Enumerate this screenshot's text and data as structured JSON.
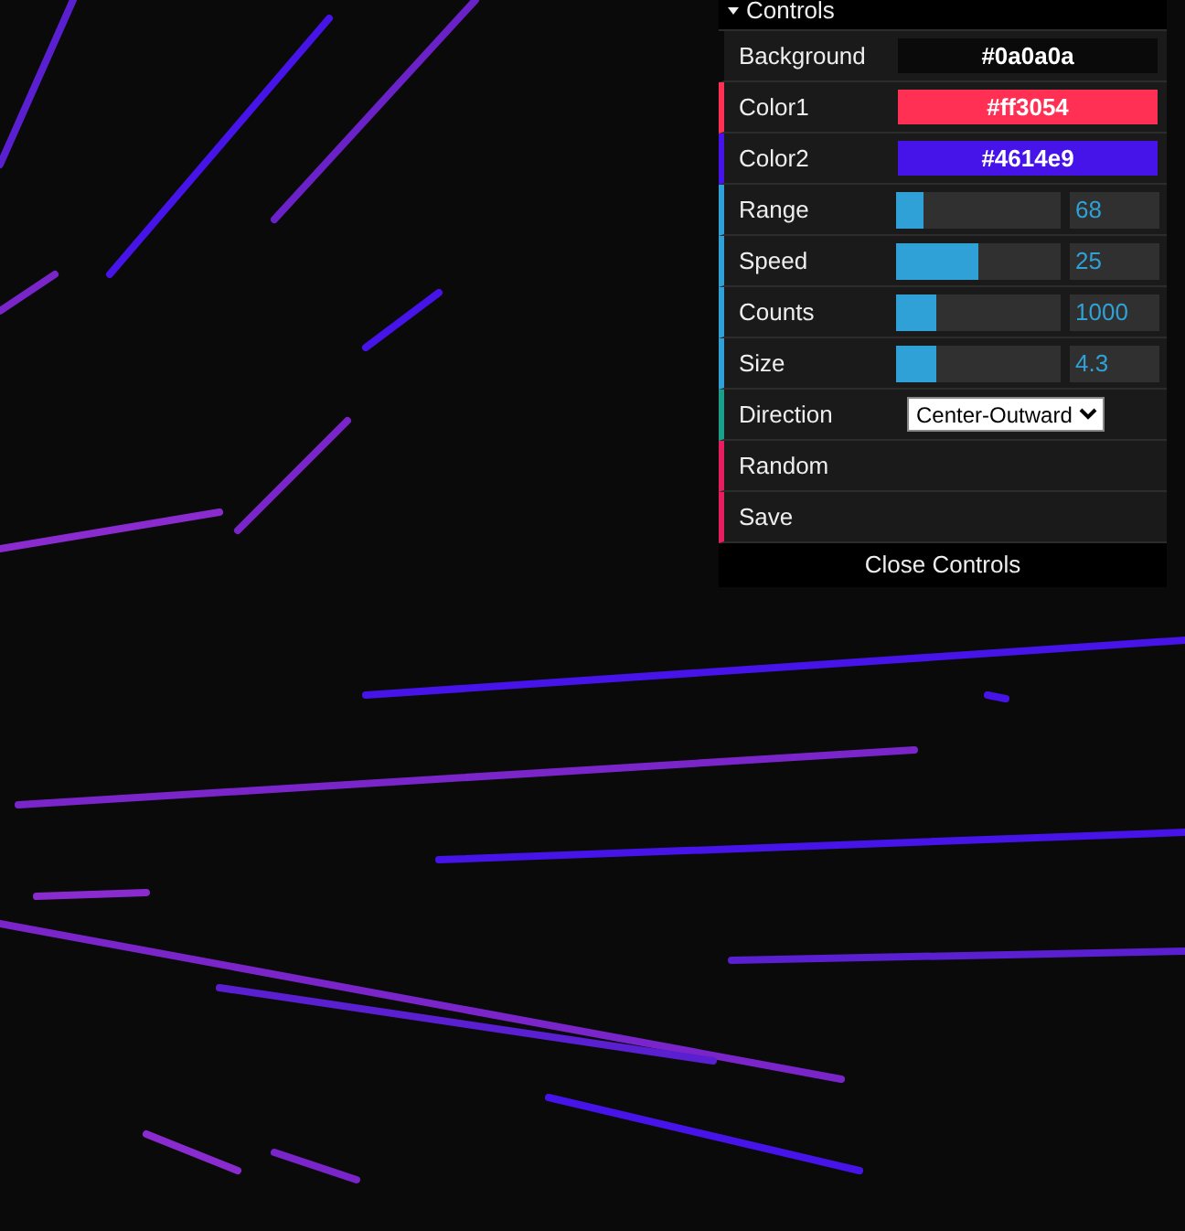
{
  "controls": {
    "title": "Controls",
    "expanded": true,
    "rows": [
      {
        "kind": "color",
        "label": "Background",
        "value": "#0a0a0a",
        "color": "#0a0a0a"
      },
      {
        "kind": "color",
        "label": "Color1",
        "value": "#ff3054",
        "color": "#ff3054"
      },
      {
        "kind": "color",
        "label": "Color2",
        "value": "#4614e9",
        "color": "#4614e9"
      },
      {
        "kind": "slider",
        "label": "Range",
        "value": "68",
        "level": 0.17
      },
      {
        "kind": "slider",
        "label": "Speed",
        "value": "25",
        "level": 0.5
      },
      {
        "kind": "slider",
        "label": "Counts",
        "value": "1000",
        "level": 0.24
      },
      {
        "kind": "slider",
        "label": "Size",
        "value": "4.3",
        "level": 0.24
      },
      {
        "kind": "select",
        "label": "Direction",
        "value": "Center-Outward"
      },
      {
        "kind": "button",
        "label": "Random"
      },
      {
        "kind": "button",
        "label": "Save"
      }
    ],
    "close_button": "Close Controls"
  }
}
